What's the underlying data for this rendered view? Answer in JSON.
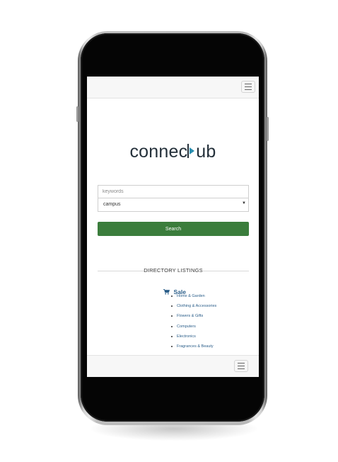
{
  "navbar": {
    "toggle_icon": "hamburger-menu-icon"
  },
  "logo": {
    "text_start": "connec",
    "text_end": "ub",
    "accent_color": "#2a8fb0"
  },
  "search": {
    "keywords_placeholder": "keywords",
    "campus_value": "campus",
    "button_label": "Search",
    "button_color": "#3b7d3c"
  },
  "directory": {
    "heading": "DIRECTORY LISTINGS",
    "category": {
      "icon": "shopping-cart-icon",
      "label": "Sale",
      "items": [
        "Home & Garden",
        "Clothing & Accessories",
        "Flowers & Gifts",
        "Computers",
        "Electronics",
        "Fragrances & Beauty"
      ]
    }
  }
}
